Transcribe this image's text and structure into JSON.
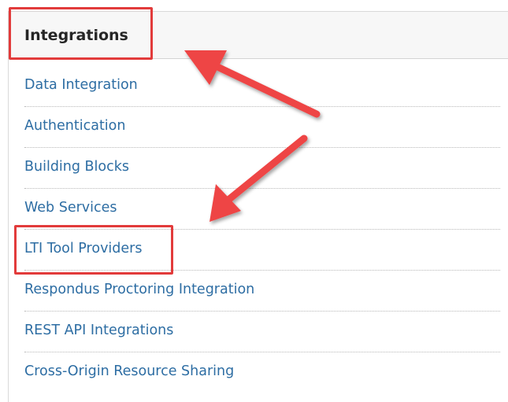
{
  "panel": {
    "title": "Integrations",
    "links": [
      "Data Integration",
      "Authentication",
      "Building Blocks",
      "Web Services",
      "LTI Tool Providers",
      "Respondus Proctoring Integration",
      "REST API Integrations",
      "Cross-Origin Resource Sharing"
    ]
  },
  "annotation": {
    "color": "#e23b3b",
    "highlighted_items": [
      "Integrations",
      "LTI Tool Providers"
    ]
  }
}
